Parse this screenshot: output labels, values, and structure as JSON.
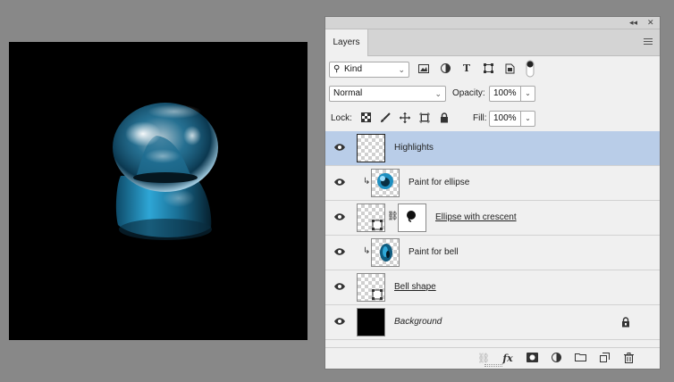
{
  "panel": {
    "tab_label": "Layers",
    "collapse_glyph": "◂◂",
    "close_glyph": "✕"
  },
  "filter": {
    "kind_label": "Kind",
    "filter_icons": [
      "image-filter-icon",
      "adjustment-filter-icon",
      "type-filter-icon",
      "shape-filter-icon",
      "smart-object-filter-icon"
    ]
  },
  "blend": {
    "mode": "Normal",
    "opacity_label": "Opacity:",
    "opacity_value": "100%"
  },
  "locks": {
    "label": "Lock:",
    "fill_label": "Fill:",
    "fill_value": "100%"
  },
  "layers": [
    {
      "name": "Highlights",
      "selected": true
    },
    {
      "name": "Paint for ellipse",
      "clipped": true
    },
    {
      "name": "Ellipse with crescent",
      "masked": true
    },
    {
      "name": "Paint for bell",
      "clipped": true
    },
    {
      "name": "Bell shape"
    },
    {
      "name": "Background",
      "locked": true
    }
  ],
  "colors": {
    "selection": "#b9cde8",
    "panel": "#f0f0f0",
    "workspace": "#888888",
    "glass_blue": "#1b8fc0"
  }
}
